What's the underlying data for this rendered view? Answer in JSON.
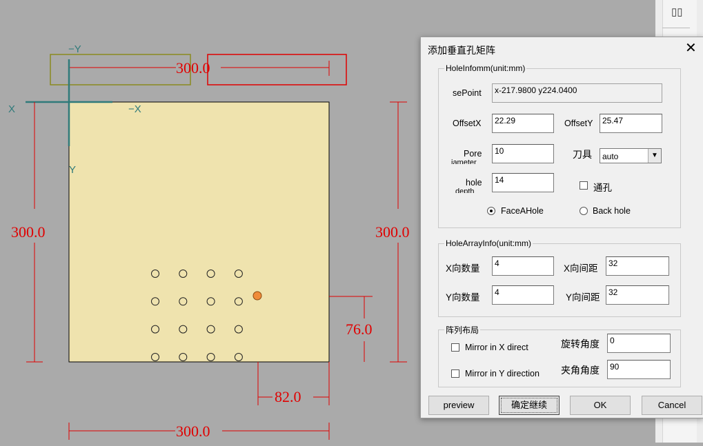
{
  "canvas": {
    "axes": {
      "neg_y": "−Y",
      "x": "X",
      "neg_x": "−X",
      "y": "Y"
    },
    "dimensions": {
      "top_width": "300.0",
      "left_height": "300.0",
      "right_height": "300.0",
      "offset_y": "76.0",
      "offset_x": "82.0",
      "bottom_width": "300.0"
    },
    "hole_grid": {
      "rows": 4,
      "cols": 4,
      "partial_last_row": true
    },
    "colors": {
      "panel": "#efe3ae",
      "dimension": "#e00000",
      "axis": "#2f7a7a",
      "selection_olive": "#8a8a1e",
      "marker": "#f08c3a"
    }
  },
  "toolbar": {
    "icon": "panel-split-icon"
  },
  "dialog": {
    "title": "添加垂直孔矩阵",
    "close": "✕",
    "hole_info": {
      "legend": "HoleInfomm(unit:mm)",
      "base_point_label": "sePoint",
      "base_point_value": "x-217.9800 y224.0400",
      "offset_x_label": "OffsetX",
      "offset_x_value": "22.29",
      "offset_y_label": "OffsetY",
      "offset_y_value": "25.47",
      "pore_label": "Pore",
      "pore_label2": "iameter",
      "pore_value": "10",
      "tool_label": "刀具",
      "tool_value": "auto",
      "depth_label": "hole",
      "depth_label2": "depth",
      "depth_value": "14",
      "through_label": "通孔",
      "face_a_label": "FaceAHole",
      "back_label": "Back hole"
    },
    "array_info": {
      "legend": "HoleArrayInfo(unit:mm)",
      "x_count_label": "X向数量",
      "x_count_value": "4",
      "x_spacing_label": "X向间距",
      "x_spacing_value": "32",
      "y_count_label": "Y向数量",
      "y_count_value": "4",
      "y_spacing_label": "Y向间距",
      "y_spacing_value": "32"
    },
    "layout": {
      "legend": "阵列布局",
      "mirror_x_label": "Mirror in X direct",
      "mirror_y_label": "Mirror in Y direction",
      "rotation_label": "旋转角度",
      "rotation_value": "0",
      "angle_label": "夹角角度",
      "angle_value": "90"
    },
    "buttons": {
      "preview": "preview",
      "confirm_continue": "确定继续",
      "ok": "OK",
      "cancel": "Cancel"
    }
  }
}
